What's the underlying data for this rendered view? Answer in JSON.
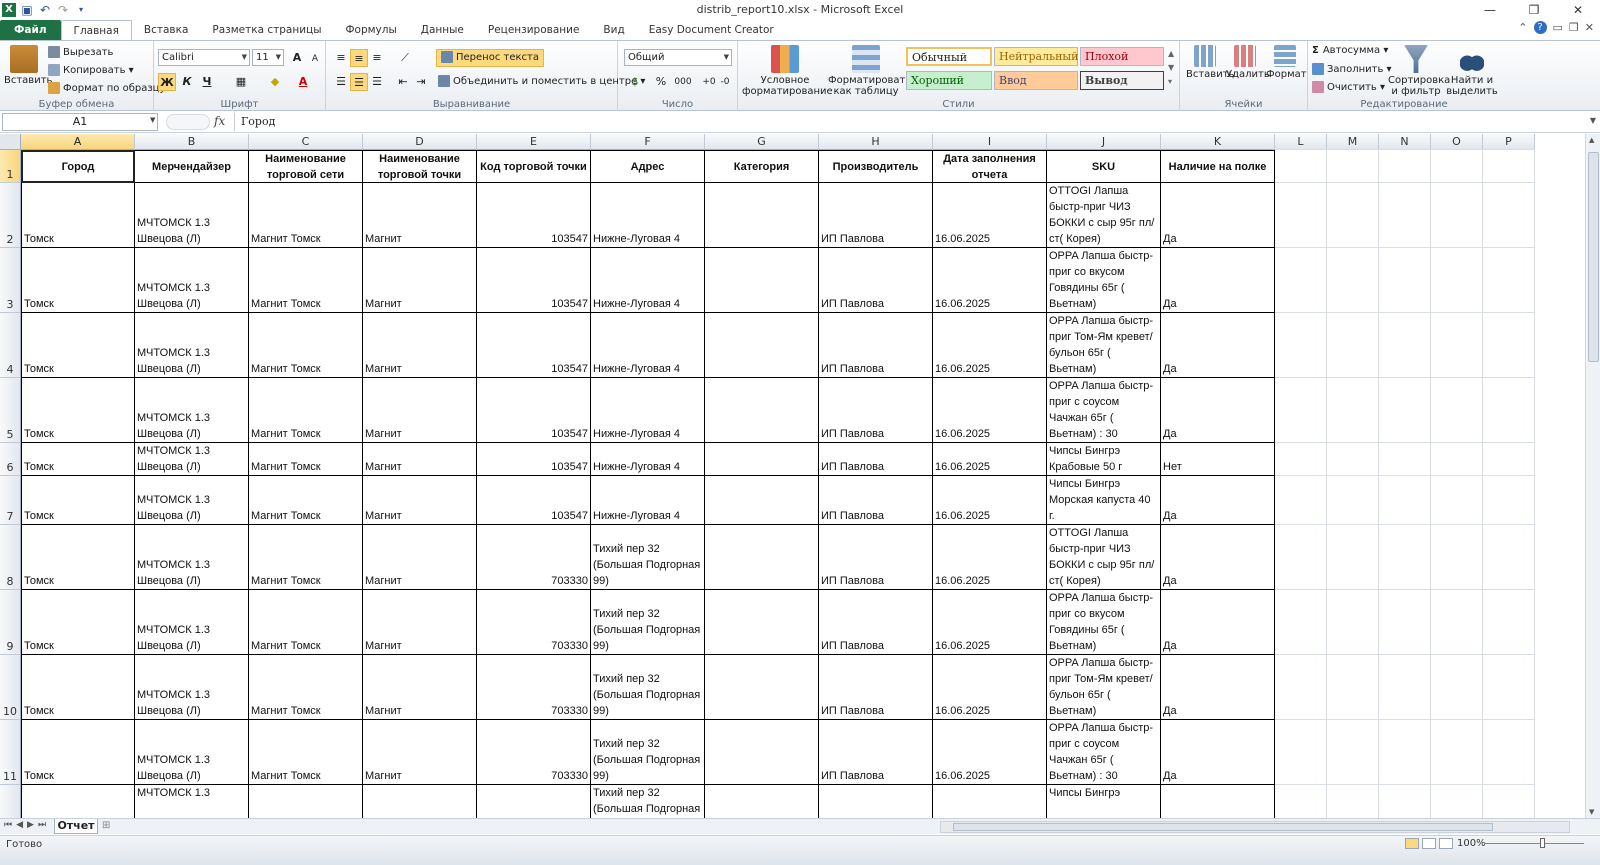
{
  "window": {
    "title": "distrib_report10.xlsx  -  Microsoft Excel",
    "controls": [
      "—",
      "❐",
      "✕"
    ]
  },
  "tabs": [
    {
      "label": "Файл"
    },
    {
      "label": "Главная"
    },
    {
      "label": "Вставка"
    },
    {
      "label": "Разметка страницы"
    },
    {
      "label": "Формулы"
    },
    {
      "label": "Данные"
    },
    {
      "label": "Рецензирование"
    },
    {
      "label": "Вид"
    },
    {
      "label": "Easy Document Creator"
    }
  ],
  "ribbon": {
    "clipboard": {
      "paste": "Вставить",
      "cut": "Вырезать",
      "copy": "Копировать",
      "format_painter": "Формат по образцу",
      "label": "Буфер обмена"
    },
    "font": {
      "name": "Calibri",
      "size": "11",
      "bold": "Ж",
      "italic": "К",
      "underline": "Ч",
      "grow": "A",
      "shrink": "A",
      "label": "Шрифт"
    },
    "alignment": {
      "wrap": "Перенос текста",
      "merge": "Объединить и поместить в центре",
      "label": "Выравнивание"
    },
    "number": {
      "format": "Общий",
      "percent": "%",
      "thousands": "000",
      "label": "Число"
    },
    "styles": {
      "conditional": "Условное форматирование",
      "as_table": "Форматировать как таблицу",
      "normal": "Обычный",
      "neutral": "Нейтральный",
      "bad": "Плохой",
      "good": "Хороший",
      "input": "Ввод",
      "output": "Вывод",
      "label": "Стили"
    },
    "cells": {
      "insert": "Вставить",
      "delete": "Удалить",
      "format": "Формат",
      "label": "Ячейки"
    },
    "editing": {
      "autosum": "Автосумма",
      "fill": "Заполнить",
      "clear": "Очистить",
      "sort": "Сортировка и фильтр",
      "find": "Найти и выделить",
      "label": "Редактирование"
    }
  },
  "formula_bar": {
    "name_box": "A1",
    "fx": "fx",
    "formula": "Город"
  },
  "columns": [
    "A",
    "B",
    "C",
    "D",
    "E",
    "F",
    "G",
    "H",
    "I",
    "J",
    "K",
    "L",
    "M",
    "N",
    "O",
    "P"
  ],
  "headers": [
    "Город",
    "Мерчендайзер",
    "Наименование торговой сети",
    "Наименование торговой точки",
    "Код торговой точки",
    "Адрес",
    "Категория",
    "Производитель",
    "Дата заполнения отчета",
    "SKU",
    "Наличие на полке"
  ],
  "rows": [
    {
      "n": "2",
      "cells": [
        "Томск",
        "МЧТОМСК 1.3 Швецова (Л)",
        "Магнит Томск",
        "Магнит",
        "103547",
        "Нижне-Луговая 4",
        "",
        "ИП Павлова",
        "16.06.2025",
        "OTTOGI Лапша быстр-приг ЧИЗ БОККИ с сыр 95г пл/ ст( Корея)",
        "Да"
      ]
    },
    {
      "n": "3",
      "cells": [
        "Томск",
        "МЧТОМСК 1.3 Швецова (Л)",
        "Магнит Томск",
        "Магнит",
        "103547",
        "Нижне-Луговая 4",
        "",
        "ИП Павлова",
        "16.06.2025",
        "OPPA Лапша быстр-приг со вкусом Говядины 65г ( Вьетнам)",
        "Да"
      ]
    },
    {
      "n": "4",
      "cells": [
        "Томск",
        "МЧТОМСК 1.3 Швецова (Л)",
        "Магнит Томск",
        "Магнит",
        "103547",
        "Нижне-Луговая 4",
        "",
        "ИП Павлова",
        "16.06.2025",
        "OPPA Лапша быстр-приг Том-Ям кревет/ бульон 65г ( Вьетнам)",
        "Да"
      ]
    },
    {
      "n": "5",
      "cells": [
        "Томск",
        "МЧТОМСК 1.3 Швецова (Л)",
        "Магнит Томск",
        "Магнит",
        "103547",
        "Нижне-Луговая 4",
        "",
        "ИП Павлова",
        "16.06.2025",
        "OPPA Лапша быстр-приг с соусом Чачжан 65г ( Вьетнам) : 30",
        "Да"
      ]
    },
    {
      "n": "6",
      "cells": [
        "Томск",
        "МЧТОМСК 1.3 Швецова (Л)",
        "Магнит Томск",
        "Магнит",
        "103547",
        "Нижне-Луговая 4",
        "",
        "ИП Павлова",
        "16.06.2025",
        "Чипсы Бингрэ Крабовые 50 г",
        "Нет"
      ]
    },
    {
      "n": "7",
      "cells": [
        "Томск",
        "МЧТОМСК 1.3 Швецова (Л)",
        "Магнит Томск",
        "Магнит",
        "103547",
        "Нижне-Луговая 4",
        "",
        "ИП Павлова",
        "16.06.2025",
        "Чипсы Бингрэ Морская капуста 40 г.",
        "Да"
      ]
    },
    {
      "n": "8",
      "cells": [
        "Томск",
        "МЧТОМСК 1.3 Швецова (Л)",
        "Магнит Томск",
        "Магнит",
        "703330",
        "Тихий пер 32 (Большая Подгорная 99)",
        "",
        "ИП Павлова",
        "16.06.2025",
        "OTTOGI Лапша быстр-приг ЧИЗ БОККИ с сыр 95г пл/ ст( Корея)",
        "Да"
      ]
    },
    {
      "n": "9",
      "cells": [
        "Томск",
        "МЧТОМСК 1.3 Швецова (Л)",
        "Магнит Томск",
        "Магнит",
        "703330",
        "Тихий пер 32 (Большая Подгорная 99)",
        "",
        "ИП Павлова",
        "16.06.2025",
        "OPPA Лапша быстр-приг со вкусом Говядины 65г ( Вьетнам)",
        "Да"
      ]
    },
    {
      "n": "10",
      "cells": [
        "Томск",
        "МЧТОМСК 1.3 Швецова (Л)",
        "Магнит Томск",
        "Магнит",
        "703330",
        "Тихий пер 32 (Большая Подгорная 99)",
        "",
        "ИП Павлова",
        "16.06.2025",
        "OPPA Лапша быстр-приг Том-Ям кревет/ бульон 65г ( Вьетнам)",
        "Да"
      ]
    },
    {
      "n": "11",
      "cells": [
        "Томск",
        "МЧТОМСК 1.3 Швецова (Л)",
        "Магнит Томск",
        "Магнит",
        "703330",
        "Тихий пер 32 (Большая Подгорная 99)",
        "",
        "ИП Павлова",
        "16.06.2025",
        "OPPA Лапша быстр-приг с соусом Чачжан 65г ( Вьетнам) : 30",
        "Да"
      ]
    },
    {
      "n": "12",
      "cells": [
        "",
        "МЧТОМСК 1.3",
        "",
        "",
        "",
        "Тихий пер 32 (Большая Подгорная",
        "",
        "",
        "",
        "Чипсы Бингрэ",
        ""
      ]
    }
  ],
  "sheet": {
    "tab": "Отчет"
  },
  "status": {
    "text": "Готово",
    "zoom": "100%"
  }
}
